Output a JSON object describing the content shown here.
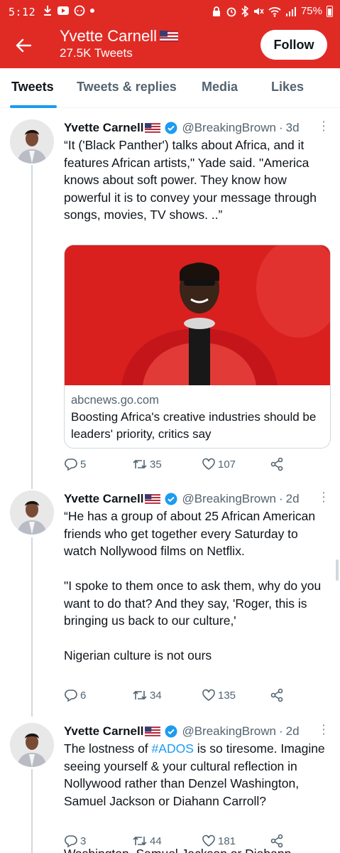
{
  "status_bar": {
    "time": "5:12",
    "battery": "75%",
    "left_icons": [
      "download-icon",
      "youtube-icon",
      "chat-icon",
      "dot-icon"
    ],
    "right_icons": [
      "lock-icon",
      "alarm-icon",
      "bluetooth-icon",
      "mute-icon",
      "wifi-icon",
      "signal-icon",
      "battery-icon"
    ]
  },
  "header": {
    "name": "Yvette Carnell",
    "tweet_count": "27.5K Tweets",
    "follow_label": "Follow",
    "back_icon": "arrow-left-icon"
  },
  "tabs": [
    {
      "label": "Tweets",
      "active": true
    },
    {
      "label": "Tweets & replies",
      "active": false
    },
    {
      "label": "Media",
      "active": false
    },
    {
      "label": "Likes",
      "active": false
    }
  ],
  "tweets": [
    {
      "name": "Yvette Carnell",
      "handle": "@BreakingBrown",
      "time": "3d",
      "text": "“It ('Black Panther') talks about Africa, and it features African artists,\" Yade said. \"America knows about soft power. They know how powerful it is to convey your message through songs, movies, TV shows. ..”",
      "card": {
        "domain": "abcnews.go.com",
        "title": "Boosting Africa's creative industries should be leaders' priority, critics say"
      },
      "replies": "5",
      "retweets": "35",
      "likes": "107"
    },
    {
      "name": "Yvette Carnell",
      "handle": "@BreakingBrown",
      "time": "2d",
      "text": "“He has a group of about 25 African American friends who get together every Saturday to watch Nollywood films on Netflix.\n\n\"I spoke to them once to ask them, why do you want to do that? And they say, 'Roger, this is bringing us back to our culture,'\n\nNigerian culture is not ours",
      "replies": "6",
      "retweets": "34",
      "likes": "135"
    },
    {
      "name": "Yvette Carnell",
      "handle": "@BreakingBrown",
      "time": "2d",
      "text_before": "The lostness of ",
      "hashtag": "#ADOS",
      "text_after": " is so tiresome. Imagine seeing yourself & your cultural reflection in Nollywood rather than Denzel Washington, Samuel Jackson or Diahann Carroll?",
      "replies": "3",
      "retweets": "44",
      "likes": "181",
      "peek_text": "Washington, Samuel Jackson or Diahann"
    }
  ],
  "colors": {
    "brand_red": "#e02b25",
    "accent_blue": "#1d9bf0",
    "secondary_text": "#536471"
  }
}
